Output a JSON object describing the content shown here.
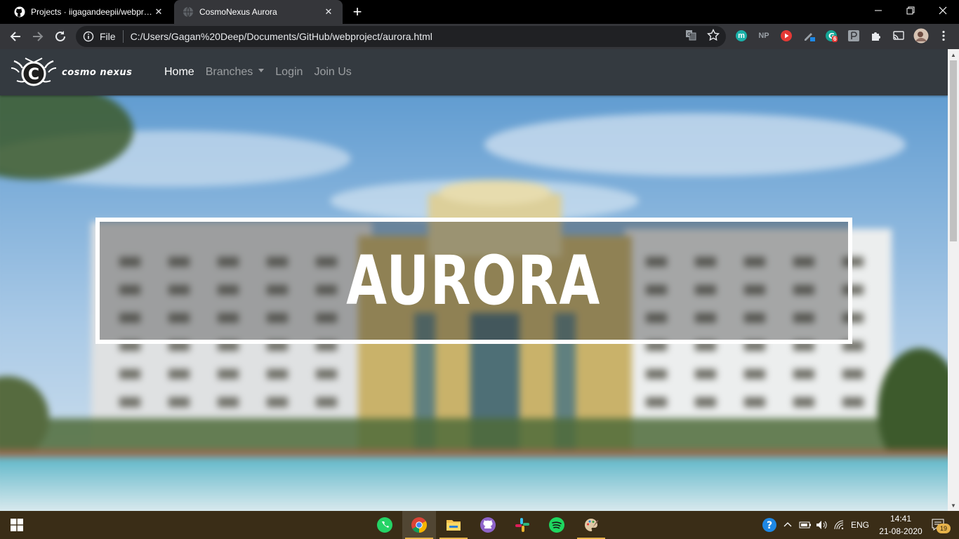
{
  "browser": {
    "tabs": [
      {
        "title": "Projects · iigagandeepii/webproje",
        "favicon": "github-icon",
        "active": false
      },
      {
        "title": "CosmoNexus Aurora",
        "favicon": "globe-icon",
        "active": true
      }
    ],
    "address": {
      "scheme_label": "File",
      "url": "C:/Users/Gagan%20Deep/Documents/GitHub/webproject/aurora.html"
    },
    "extensions": {
      "np_label": "NP",
      "m_label": "m",
      "badge_count": "6"
    }
  },
  "site": {
    "brand": "cosmo nexus",
    "brand_logo_letter": "C",
    "nav": {
      "home": "Home",
      "branches": "Branches",
      "login": "Login",
      "join": "Join Us"
    },
    "hero": {
      "title": "AURORA"
    }
  },
  "taskbar": {
    "language": "ENG",
    "time": "14:41",
    "date": "21-08-2020",
    "notification_count": "19",
    "accent": "#e6b24a"
  }
}
